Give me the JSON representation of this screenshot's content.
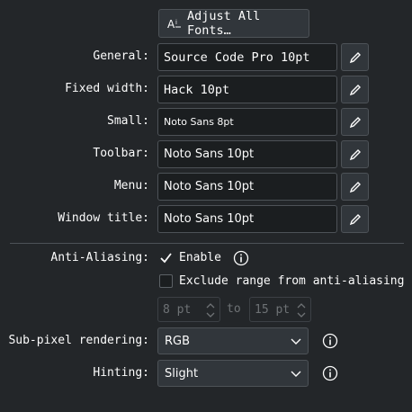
{
  "adjust_button": {
    "label": "Adjust All Fonts…",
    "icon": "font-adjust-icon"
  },
  "fonts": [
    {
      "label": "General:",
      "value": "Source Code Pro 10pt"
    },
    {
      "label": "Fixed width:",
      "value": "Hack 10pt"
    },
    {
      "label": "Small:",
      "value": "Noto Sans 8pt"
    },
    {
      "label": "Toolbar:",
      "value": "Noto Sans 10pt"
    },
    {
      "label": "Menu:",
      "value": "Noto Sans 10pt"
    },
    {
      "label": "Window title:",
      "value": "Noto Sans 10pt"
    }
  ],
  "antialiasing": {
    "label": "Anti-Aliasing:",
    "enable_label": "Enable",
    "enable_checked": true,
    "exclude_label": "Exclude range from anti-aliasing",
    "exclude_checked": false,
    "range_from": "8 pt",
    "range_to_label": "to",
    "range_to": "15 pt"
  },
  "subpixel": {
    "label": "Sub-pixel rendering:",
    "value": "RGB"
  },
  "hinting": {
    "label": "Hinting:",
    "value": "Slight"
  },
  "colors": {
    "background": "#232629",
    "field": "#1b1e20",
    "border": "#4d5257",
    "accent": "#3daee9"
  }
}
